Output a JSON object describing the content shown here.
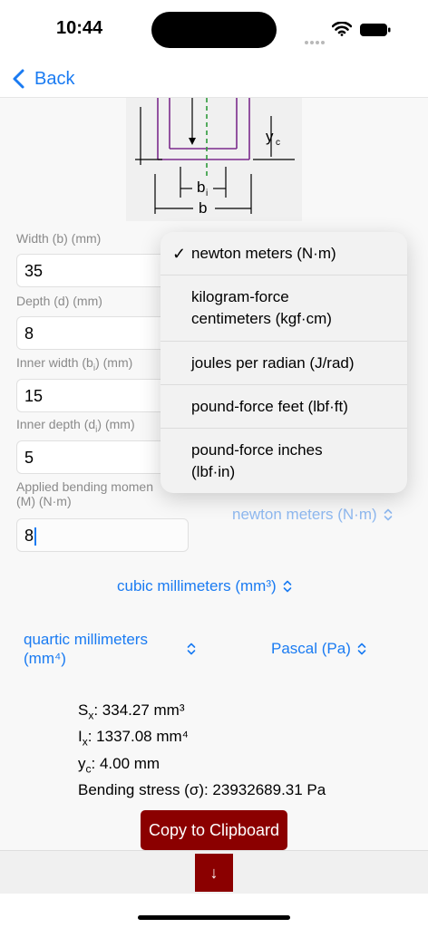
{
  "status": {
    "time": "10:44"
  },
  "nav": {
    "back_label": "Back"
  },
  "diagram": {
    "yc": "y",
    "yc_sub": "c",
    "bi": "b",
    "bi_sub": "i",
    "b": "b"
  },
  "fields": [
    {
      "label": "Width (b) (mm)",
      "value": "35"
    },
    {
      "label": "Depth (d) (mm)",
      "value": "8"
    },
    {
      "label_pre": "Inner width (b",
      "label_sub": "i",
      "label_post": ") (mm)",
      "value": "15"
    },
    {
      "label_pre": "Inner depth (d",
      "label_sub": "i",
      "label_post": ") (mm)",
      "value": "5"
    },
    {
      "label_line1": "Applied bending momen",
      "label_line2": "(M) (N·m)",
      "value": "8"
    }
  ],
  "pickers": {
    "moment_unit": "newton meters (N·m)",
    "section_modulus_unit": "cubic millimeters (mm³)",
    "inertia_unit_line1": "quartic millimeters",
    "inertia_unit_line2": "(mm⁴)",
    "stress_unit": "Pascal (Pa)"
  },
  "results": {
    "sx_label": "S",
    "sx_sub": "x",
    "sx_value": ": 334.27 mm³",
    "ix_label": "I",
    "ix_sub": "x",
    "ix_value": ": 1337.08 mm⁴",
    "yc_label": "y",
    "yc_sub": "c",
    "yc_value": ": 4.00  mm",
    "stress": "Bending stress (σ): 23932689.31  Pa"
  },
  "copy_label": "Copy to Clipboard",
  "scroll_down_label": "↓",
  "menu": {
    "items": [
      {
        "label": "newton meters (N·m)",
        "selected": "✓"
      },
      {
        "label_line1": "kilogram-force",
        "label_line2": "centimeters (kgf·cm)"
      },
      {
        "label": "joules per radian (J/rad)"
      },
      {
        "label": "pound-force feet (lbf·ft)"
      },
      {
        "label_line1": "pound-force inches",
        "label_line2": "(lbf·in)"
      }
    ]
  },
  "colors": {
    "accent": "#1a7bf2",
    "button": "#8b0000",
    "diagram_beam": "#7b2a8c",
    "diagram_axis": "#2e9a3a"
  }
}
